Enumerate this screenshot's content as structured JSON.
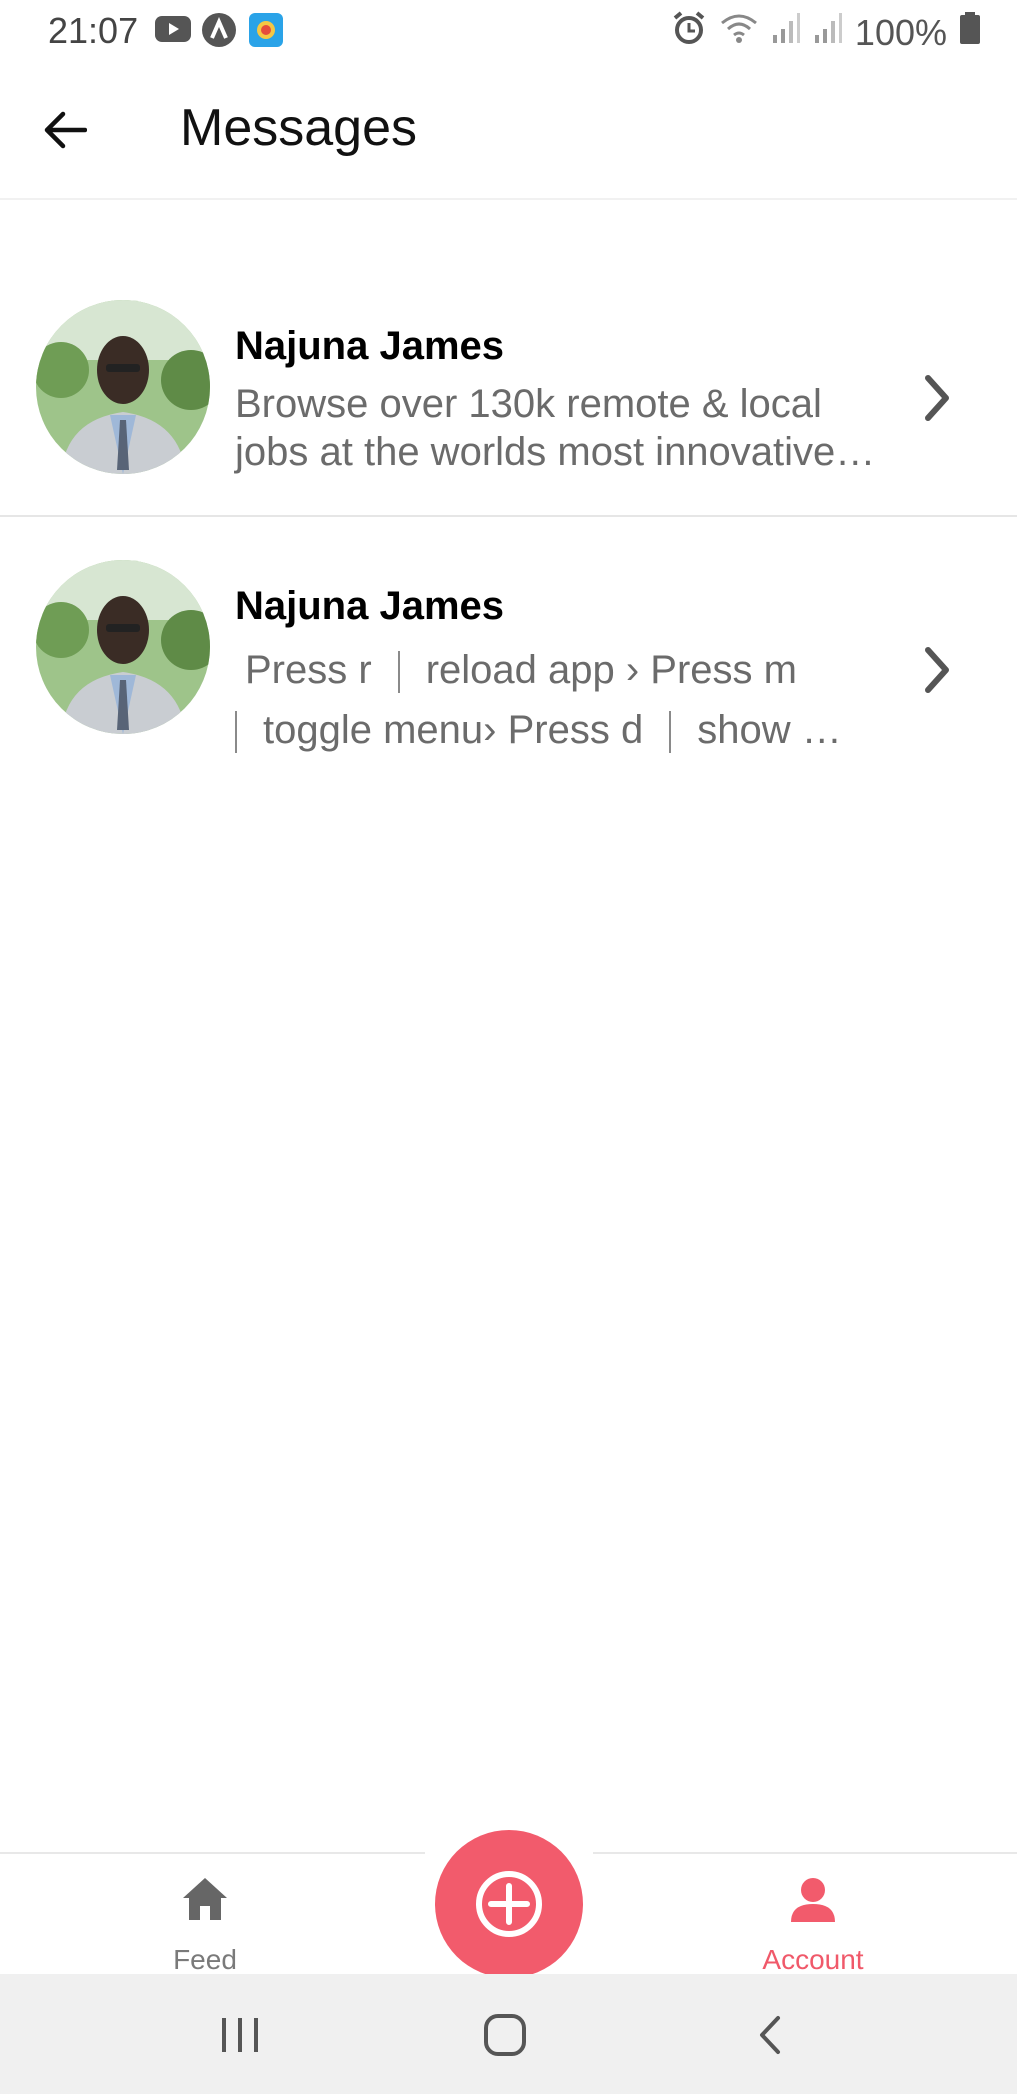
{
  "status_bar": {
    "time": "21:07",
    "battery": "100%",
    "left_icons": [
      "youtube-icon",
      "app-a-icon",
      "browser-icon"
    ],
    "right_icons": [
      "alarm-icon",
      "wifi-icon",
      "signal-icon",
      "signal-icon-2",
      "battery-icon"
    ]
  },
  "header": {
    "title": "Messages",
    "back_icon": "arrow-left-icon"
  },
  "messages": [
    {
      "sender": "Najuna James",
      "preview_line1": "Browse over 130k remote & local",
      "preview_line2": "jobs at the worlds most innovative…",
      "avatar": "user-avatar",
      "chevron": "chevron-right-icon"
    },
    {
      "sender": "Najuna James",
      "preview_seg1": "Press r",
      "preview_seg2": "reload app › Press m",
      "preview_seg3": "toggle menu› Press d",
      "preview_seg4": "show …",
      "avatar": "user-avatar",
      "chevron": "chevron-right-icon"
    }
  ],
  "bottom_nav": {
    "feed_label": "Feed",
    "account_label": "Account",
    "add_icon": "plus-icon",
    "active": "Account",
    "accent_color": "#f25b6c"
  },
  "system_nav": {
    "icons": [
      "recent-apps-icon",
      "home-icon",
      "back-icon"
    ]
  }
}
